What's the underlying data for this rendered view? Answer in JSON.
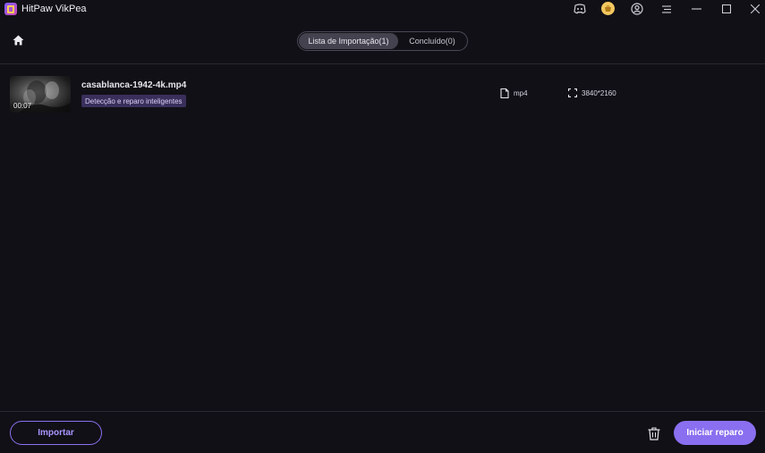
{
  "app": {
    "title": "HitPaw VikPea",
    "accent_color": "#8a6ff0",
    "background_color": "#111016"
  },
  "titlebar": {
    "icons": [
      "discord-icon",
      "shop-coin-icon",
      "account-icon",
      "menu-icon",
      "minimize-icon",
      "maximize-icon",
      "close-icon"
    ]
  },
  "header": {
    "home_icon": "home-icon",
    "tabs": [
      {
        "label": "Lista de Importação(1)",
        "active": true
      },
      {
        "label": "Concluído(0)",
        "active": false
      }
    ]
  },
  "files": [
    {
      "name": "casablanca-1942-4k.mp4",
      "duration": "00:07",
      "badge": "Detecção e reparo inteligentes",
      "format": "mp4",
      "resolution": "3840*2160"
    }
  ],
  "footer": {
    "import_label": "Importar",
    "repair_label": "Iniciar reparo",
    "trash_icon": "trash-icon"
  }
}
